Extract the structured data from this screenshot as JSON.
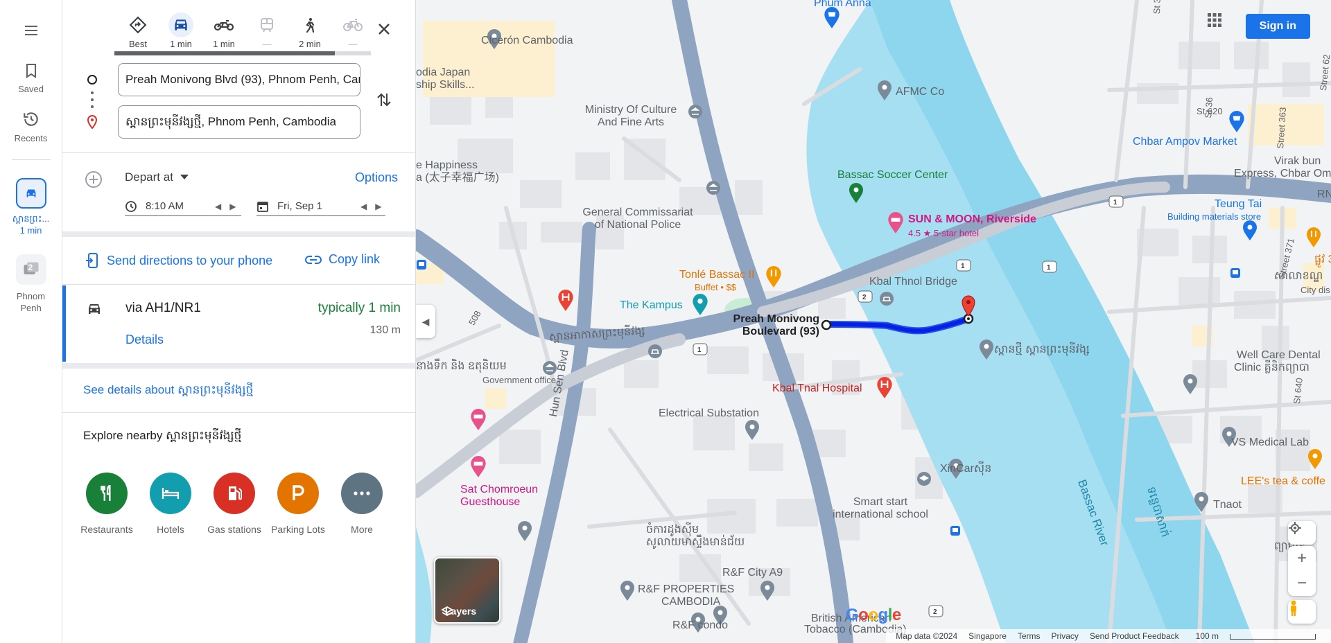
{
  "rail": {
    "saved_label": "Saved",
    "recents_label": "Recents",
    "recent_route_label": "ស្ពានព្រះ...",
    "recent_route_duration": "1 min",
    "recent_place_label": "Phnom Penh",
    "recent_place_badge": "2"
  },
  "modes": [
    {
      "name": "Best",
      "icon": "diamond-directions-icon",
      "active": false
    },
    {
      "name": "1 min",
      "icon": "car-icon",
      "active": true
    },
    {
      "name": "1 min",
      "icon": "motorcycle-icon",
      "active": false
    },
    {
      "name": "—",
      "icon": "transit-icon",
      "active": false
    },
    {
      "name": "2 min",
      "icon": "walk-icon",
      "active": false
    },
    {
      "name": "—",
      "icon": "bicycle-icon",
      "active": false
    }
  ],
  "origin": {
    "value": "Preah Monivong Blvd (93), Phnom Penh, Cambodia"
  },
  "destination": {
    "value": "ស្ពានព្រះមុនីវង្សថ្មី, Phnom Penh, Cambodia"
  },
  "depart": {
    "label": "Depart at",
    "options_label": "Options",
    "time": "8:10 AM",
    "date": "Fri, Sep 1"
  },
  "actions": {
    "send_label": "Send directions to your phone",
    "copy_label": "Copy link"
  },
  "route": {
    "via": "via AH1/NR1",
    "duration": "typically 1 min",
    "distance": "130 m",
    "details_label": "Details"
  },
  "see_details": "See details about ស្ពានព្រះមុនីវង្សថ្មី",
  "explore": {
    "title": "Explore nearby ស្ពានព្រះមុនីវង្សថ្មី",
    "categories": [
      {
        "label": "Restaurants",
        "color": "#188038",
        "icon": "fork-knife-icon"
      },
      {
        "label": "Hotels",
        "color": "#129eaf",
        "icon": "bed-icon"
      },
      {
        "label": "Gas stations",
        "color": "#d93025",
        "icon": "gas-pump-icon"
      },
      {
        "label": "Parking Lots",
        "color": "#e37400",
        "icon": "parking-icon"
      },
      {
        "label": "More",
        "color": "#5f7482",
        "icon": "more-dots-icon"
      }
    ]
  },
  "map": {
    "sign_in": "Sign in",
    "layers_label": "Layers",
    "labels": {
      "phum_anna": "Phum Anna",
      "ciceron": "Cicerón Cambodia",
      "japan_school_1": "odia Japan",
      "japan_school_2": "ship Skills...",
      "ministry_1": "Ministry Of Culture",
      "ministry_2": "And Fine Arts",
      "afmc": "AFMC Co",
      "chbar_market": "Chbar Ampov Market",
      "happiness_1": "e Happiness",
      "happiness_2": "a (太子幸福广场)",
      "bassac_soccer": "Bassac Soccer Center",
      "commissariat_1": "General Commissariat",
      "commissariat_2": "of National Police",
      "sun_moon": "SUN & MOON, Riverside",
      "sun_moon_rating": "4.5 ★ 5-star hotel",
      "teung_tai": "Teung Tai",
      "teung_tai_sub": "Building materials store",
      "virak_1": "Virak bun",
      "virak_2": "Express, Chbar Om",
      "tonle_bassac": "Tonlé Bassac II",
      "tonle_bassac_sub": "Buffet • $$",
      "kbal_thnol_bridge": "Kbal Thnol Bridge",
      "kampus": "The Kampus",
      "monivong_road_kh": "ស្ពានអាកាសព្រះមុនីវង្ស",
      "preah_monivong_1": "Preah Monivong",
      "preah_monivong_2": "Boulevard (93)",
      "bridge_kh": "ស្ពានថ្មី ស្ពានព្រះមុនីវង្ស",
      "gov_office_kh": "នាងទឹក និង ឧតុនិយម",
      "gov_office": "Government office",
      "kbal_tnal_hospital": "Kbal Tnal Hospital",
      "well_care_1": "Well Care Dental",
      "well_care_2": "Clinic គ្លីនិកព្យាបា",
      "electrical": "Electrical Substation",
      "vs_medical": "VS Medical Lab",
      "xincar": "XinCarស៊ីន",
      "lees": "LEE's tea & coffe",
      "tnaot": "Tnaot",
      "smart_1": "Smart start",
      "smart_2": "international school",
      "sat_1": "Sat Chomroeun",
      "sat_2": "Guesthouse",
      "center_kh_1": "ចំការដូងស៊ីម",
      "center_kh_2": "សូលាយមាស្ទឹងមាន់ជ័យ",
      "rf_a9": "R&F City A9",
      "rf_props_1": "R&F PROPERTIES",
      "rf_props_2": "CAMBODIA",
      "rf_condo": "R&F condo",
      "bat_1": "British American",
      "bat_2": "Tobacco (Cambodia)",
      "hun_sen": "Hun Sen Blvd",
      "bassac_river": "Bassac River",
      "bassac_river_kh": "ទន្លេបាសាក់",
      "st369": "St 369",
      "st36": "St 36",
      "st620": "St 620",
      "street363": "Street 363",
      "street371": "Street 371",
      "st640": "St 640",
      "street62": "Street 62",
      "rn": "RN",
      "kh_1371": "ផ្លូវ 371",
      "kh_city": "សាលាខណ្ឌ",
      "kh_city_sub": "City dis",
      "kh_right": "ព្យាម៉ាន",
      "road_508": "508",
      "shield_1": "1",
      "shield_2": "2"
    },
    "google": "Google",
    "footer": {
      "map_data": "Map data ©2024",
      "region": "Singapore",
      "terms": "Terms",
      "privacy": "Privacy",
      "feedback": "Send Product Feedback",
      "scale": "100 m"
    }
  }
}
